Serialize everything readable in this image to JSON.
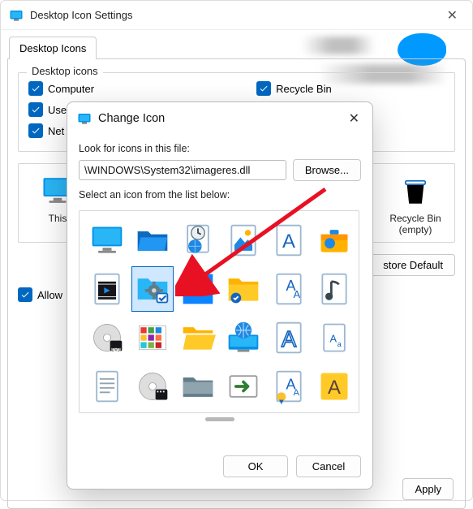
{
  "parent": {
    "title": "Desktop Icon Settings",
    "tab_label": "Desktop Icons",
    "fieldset_legend": "Desktop icons",
    "checks": {
      "computer": "Computer",
      "recycle": "Recycle Bin",
      "user": "Use",
      "network": "Net"
    },
    "preview": {
      "this_pc": "This",
      "recycle_empty_l1": "Recycle Bin",
      "recycle_empty_l2": "(empty)"
    },
    "restore_default": "store Default",
    "allow_themes": "Allow",
    "footer": {
      "apply": "Apply"
    }
  },
  "arrow_color": "#e81123",
  "modal": {
    "title": "Change Icon",
    "look_label": "Look for icons in this file:",
    "file_path": "\\WINDOWS\\System32\\imageres.dll",
    "browse": "Browse...",
    "select_label": "Select an icon from the list below:",
    "ok": "OK",
    "cancel": "Cancel",
    "icons": [
      {
        "id": "monitor-blue",
        "name": "monitor-icon"
      },
      {
        "id": "folder-blue",
        "name": "folder-blue-icon"
      },
      {
        "id": "doc-globe",
        "name": "timezone-doc-icon"
      },
      {
        "id": "picture-doc",
        "name": "picture-doc-icon"
      },
      {
        "id": "font-blue",
        "name": "font-file-blue-icon"
      },
      {
        "id": "briefcase",
        "name": "briefcase-device-icon"
      },
      {
        "id": "video-doc",
        "name": "video-doc-icon"
      },
      {
        "id": "folder-blue-gear",
        "name": "folder-gear-icon",
        "selected": true
      },
      {
        "id": "solid-square",
        "name": "desktop-solid-icon"
      },
      {
        "id": "folder-yellow",
        "name": "folder-yellow-icon"
      },
      {
        "id": "font-badge",
        "name": "font-file-badge-icon"
      },
      {
        "id": "audio-doc",
        "name": "audio-doc-icon"
      },
      {
        "id": "disc-dvd",
        "name": "dvd-disc-icon",
        "film": true
      },
      {
        "id": "defrag",
        "name": "drive-blocks-icon"
      },
      {
        "id": "folder-yellow2",
        "name": "open-folder-icon"
      },
      {
        "id": "globe-monitor",
        "name": "network-monitor-icon"
      },
      {
        "id": "font-outline",
        "name": "font-outline-blue-icon"
      },
      {
        "id": "font-small",
        "name": "font-file-small-icon"
      },
      {
        "id": "text-doc",
        "name": "text-doc-icon"
      },
      {
        "id": "disc-video",
        "name": "video-disc-icon",
        "film": true
      },
      {
        "id": "folder-dark",
        "name": "folder-dark-icon"
      },
      {
        "id": "run-arrow",
        "name": "run-shortcut-icon"
      },
      {
        "id": "font-cert",
        "name": "font-cert-icon"
      },
      {
        "id": "font-amber",
        "name": "font-amber-icon"
      },
      {
        "id": "image-doc",
        "name": "image-doc-icon"
      },
      {
        "id": "disc-plain",
        "name": "disc-plain-icon"
      }
    ]
  }
}
